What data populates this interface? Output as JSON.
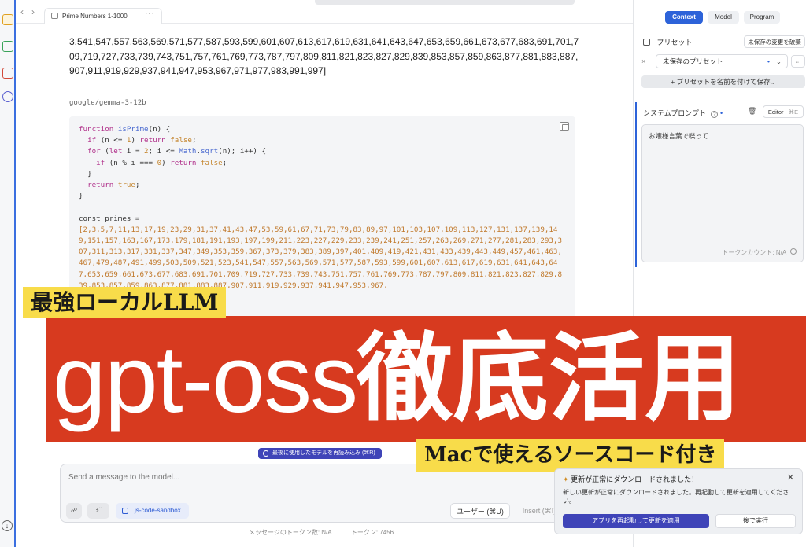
{
  "tab": {
    "title": "Prime Numbers 1-1000",
    "more": "···"
  },
  "nav": {
    "back": "‹",
    "forward": "›"
  },
  "chat": {
    "previous_text": "3,541,547,557,563,569,571,577,587,593,599,601,607,613,617,619,631,641,643,647,653,659,661,673,677,683,691,701,709,719,727,733,739,743,751,757,761,769,773,787,797,809,811,821,823,827,829,839,853,857,859,863,877,881,883,887,907,911,919,929,937,941,947,953,967,971,977,983,991,997]",
    "model_label": "google/gemma-3-12b",
    "code": {
      "primes_decl": "const primes =",
      "primes_values": "[2,3,5,7,11,13,17,19,23,29,31,37,41,43,47,53,59,61,67,71,73,79,83,89,97,101,103,107,109,113,127,131,137,139,149,151,157,163,167,173,179,181,191,193,197,199,211,223,227,229,233,239,241,251,257,263,269,271,277,281,283,293,307,311,313,317,331,337,347,349,353,359,367,373,379,383,389,397,401,409,419,421,431,433,439,443,449,457,461,463,467,479,487,491,499,503,509,521,523,541,547,557,563,569,571,577,587,593,599,601,607,613,617,619,631,641,643,647,653,659,661,673,677,683,691,701,709,719,727,733,739,743,751,757,761,769,773,787,797,809,811,821,823,827,829,839,853,857,859,863,877,881,883,887,907,911,919,929,937,941,947,953,967,"
    },
    "reload_label": "最後に使用したモデルを再読み込み (⌘R)"
  },
  "composer": {
    "placeholder": "Send a message to the model...",
    "sandbox_label": "js-code-sandbox",
    "user_label": "ユーザー (⌘U)",
    "insert_label": "Insert (⌘I)",
    "message_tokens": "メッセージのトークン数: N/A",
    "tokens": "トークン: 7456"
  },
  "panel": {
    "tabs": [
      "Context",
      "Model",
      "Program"
    ],
    "preset_label": "プリセット",
    "discard_label": "未保存の変更を破棄",
    "preset_value": "未保存のプリセット",
    "save_as_label": "プリセットを名前を付けて保存...",
    "system_prompt_label": "システムプロンプト",
    "editor_label": "Editor",
    "system_prompt_text": "お嬢様言葉で喋って",
    "token_count": "トークンカウント: N/A"
  },
  "banners": {
    "top": "最強ローカルLLM",
    "main_latin": "gpt-oss",
    "main_jp": "徹底活用",
    "bottom": "Macで使えるソースコード付き"
  },
  "notification": {
    "title": "更新が正常にダウンロードされました！",
    "body": "新しい更新が正常にダウンロードされました。再起動して更新を適用してください。",
    "primary": "アプリを再起動して更新を適用",
    "secondary": "後で実行"
  },
  "colors": {
    "accent": "#2d63d9",
    "banner_red": "#d73a1f",
    "banner_yellow": "#f8dc4a",
    "button_indigo": "#3f44b8"
  }
}
